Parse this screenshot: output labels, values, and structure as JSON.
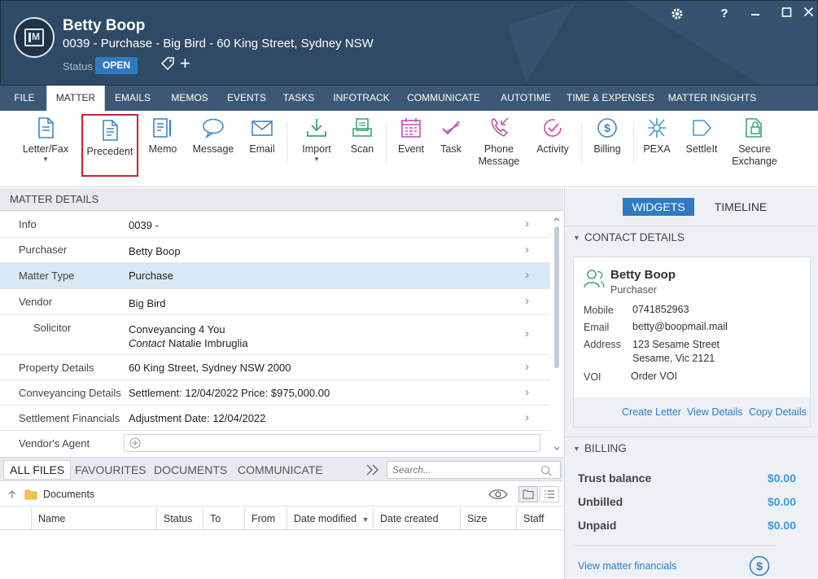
{
  "header": {
    "client_name": "Betty Boop",
    "matter_title": "0039 - Purchase - Big Bird - 60 King Street, Sydney NSW",
    "status_label": "Status",
    "status_value": "OPEN",
    "help_label": "?",
    "plus_label": "+"
  },
  "tabs": [
    "FILE",
    "MATTER",
    "EMAILS",
    "MEMOS",
    "EVENTS",
    "TASKS",
    "INFOTRACK",
    "COMMUNICATE",
    "AUTOTIME",
    "TIME & EXPENSES",
    "MATTER INSIGHTS"
  ],
  "ribbon": {
    "letter_fax": "Letter/Fax",
    "precedent": "Precedent",
    "memo": "Memo",
    "message": "Message",
    "email": "Email",
    "import": "Import",
    "scan": "Scan",
    "event": "Event",
    "task": "Task",
    "phone_message_1": "Phone",
    "phone_message_2": "Message",
    "activity": "Activity",
    "billing": "Billing",
    "pexa": "PEXA",
    "settleit": "SettleIt",
    "secure_exchange_1": "Secure",
    "secure_exchange_2": "Exchange"
  },
  "matter_details": {
    "title": "MATTER DETAILS",
    "rows": [
      {
        "key": "Info",
        "value": "0039 -"
      },
      {
        "key": "Purchaser",
        "value": "Betty Boop"
      },
      {
        "key": "Matter Type",
        "value": "Purchase"
      },
      {
        "key": "Vendor",
        "value": "Big Bird"
      },
      {
        "key": "Solicitor",
        "value": "Conveyancing 4 You",
        "contact_label": "Contact",
        "contact_value": "Natalie Imbruglia"
      },
      {
        "key": "Property Details",
        "value": "60 King Street, Sydney NSW 2000"
      },
      {
        "key": "Conveyancing Details",
        "value": "Settlement: 12/04/2022 Price: $975,000.00"
      },
      {
        "key": "Settlement Financials",
        "value": "Adjustment Date: 12/04/2022"
      },
      {
        "key": "Vendor's Agent",
        "value": ""
      }
    ]
  },
  "files": {
    "tabs": [
      "ALL FILES",
      "FAVOURITES",
      "DOCUMENTS",
      "COMMUNICATE"
    ],
    "search_placeholder": "Search...",
    "folder": "Documents",
    "columns": [
      "Name",
      "Status",
      "To",
      "From",
      "Date modified",
      "Date created",
      "Size",
      "Staff"
    ]
  },
  "right_panel": {
    "widgets_label": "WIDGETS",
    "timeline_label": "TIMELINE",
    "contact_header": "CONTACT DETAILS",
    "contact": {
      "name": "Betty Boop",
      "role": "Purchaser",
      "mobile_label": "Mobile",
      "mobile": "0741852963",
      "email_label": "Email",
      "email": "betty@boopmail.mail",
      "address_label": "Address",
      "address_1": "123 Sesame Street",
      "address_2": "Sesame, Vic 2121",
      "voi_label": "VOI",
      "voi": "Order VOI"
    },
    "contact_actions": [
      "Create Letter",
      "View Details",
      "Copy Details"
    ],
    "billing_header": "BILLING",
    "billing": [
      {
        "label": "Trust balance",
        "value": "$0.00"
      },
      {
        "label": "Unbilled",
        "value": "$0.00"
      },
      {
        "label": "Unpaid",
        "value": "$0.00"
      }
    ],
    "view_financials": "View matter financials"
  },
  "colors": {
    "header_bg": "#2f4a64",
    "accent": "#2f7ac4",
    "link": "#2e7dc4",
    "highlight": "#c9252b",
    "amount": "#3c9ae4"
  }
}
